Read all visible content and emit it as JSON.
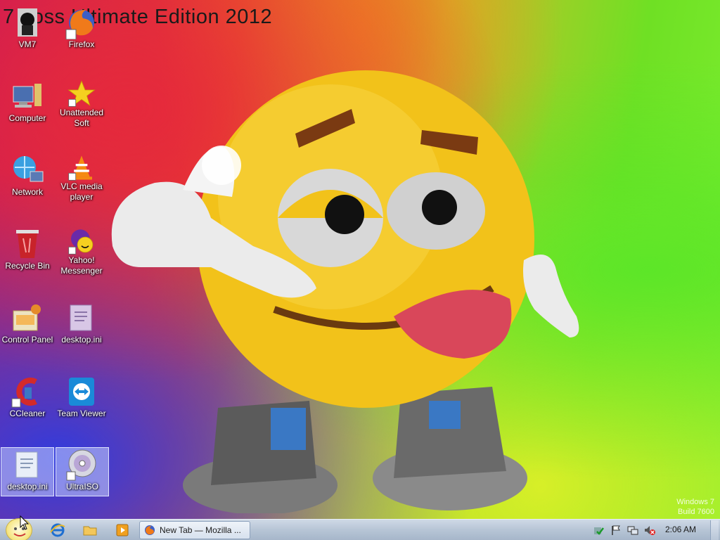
{
  "wallpaper": {
    "title": "7 Loss Ultimate Edition 2012",
    "watermark_line1": "Windows 7",
    "watermark_line2": "Build 7600"
  },
  "desktop": {
    "icons": [
      {
        "label": "VM7",
        "icon": "vm7-icon"
      },
      {
        "label": "Firefox",
        "icon": "firefox-icon"
      },
      {
        "label": "Computer",
        "icon": "computer-icon"
      },
      {
        "label": "Unattended Soft",
        "icon": "star-icon"
      },
      {
        "label": "Network",
        "icon": "network-icon"
      },
      {
        "label": "VLC media player",
        "icon": "vlc-icon"
      },
      {
        "label": "Recycle Bin",
        "icon": "recycle-bin-icon"
      },
      {
        "label": "Yahoo! Messenger",
        "icon": "yahoo-messenger-icon"
      },
      {
        "label": "Control Panel",
        "icon": "control-panel-icon"
      },
      {
        "label": "desktop.ini",
        "icon": "ini-file-icon"
      },
      {
        "label": "CCleaner",
        "icon": "ccleaner-icon"
      },
      {
        "label": "Team Viewer",
        "icon": "teamviewer-icon"
      },
      {
        "label": "desktop.ini",
        "icon": "ini-file-icon"
      },
      {
        "label": "UltraISO",
        "icon": "disc-icon"
      }
    ]
  },
  "taskbar": {
    "quick_launch": [
      "internet-explorer-icon",
      "folder-icon",
      "media-player-icon"
    ],
    "active_task_label": "New Tab — Mozilla ...",
    "tray_icons": [
      "security-check-icon",
      "flag-icon",
      "network-tray-icon",
      "volume-muted-icon"
    ],
    "clock": "2:06 AM"
  },
  "colors": {
    "taskbar": "#b7c5d6",
    "smiley": "#f2c21a",
    "tongue": "#d9475a"
  }
}
